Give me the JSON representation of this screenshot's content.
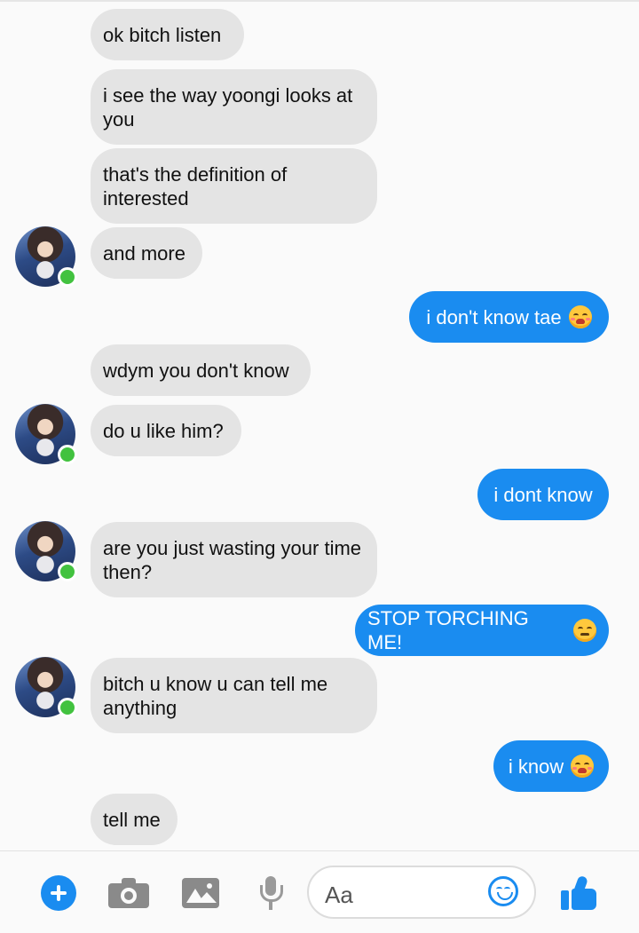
{
  "messages": [
    {
      "side": "in",
      "text": "ok bitch listen"
    },
    {
      "side": "in",
      "text": "i see the way yoongi looks at you"
    },
    {
      "side": "in",
      "text": "that's the definition of interested"
    },
    {
      "side": "in",
      "text": "and more"
    },
    {
      "side": "out",
      "text": "i don't know tae",
      "emoji": "flushed-face"
    },
    {
      "side": "in",
      "text": "wdym you don't know"
    },
    {
      "side": "in",
      "text": "do u like him?"
    },
    {
      "side": "out",
      "text": "i dont know"
    },
    {
      "side": "in",
      "text": "are you just wasting your time then?"
    },
    {
      "side": "out",
      "text": "STOP TORCHING ME!",
      "emoji": "confounded-face"
    },
    {
      "side": "in",
      "text": "bitch u know u can tell me anything"
    },
    {
      "side": "out",
      "text": "i know",
      "emoji": "flushed-face"
    },
    {
      "side": "in",
      "text": "tell me"
    }
  ],
  "composer": {
    "placeholder": "Aa",
    "icons": [
      "plus-icon",
      "camera-icon",
      "image-icon",
      "microphone-icon",
      "emoji-icon",
      "thumbs-up-icon"
    ]
  },
  "colors": {
    "accent": "#1a8cf0",
    "incoming_bubble": "#e4e4e4",
    "online": "#42c23f"
  }
}
